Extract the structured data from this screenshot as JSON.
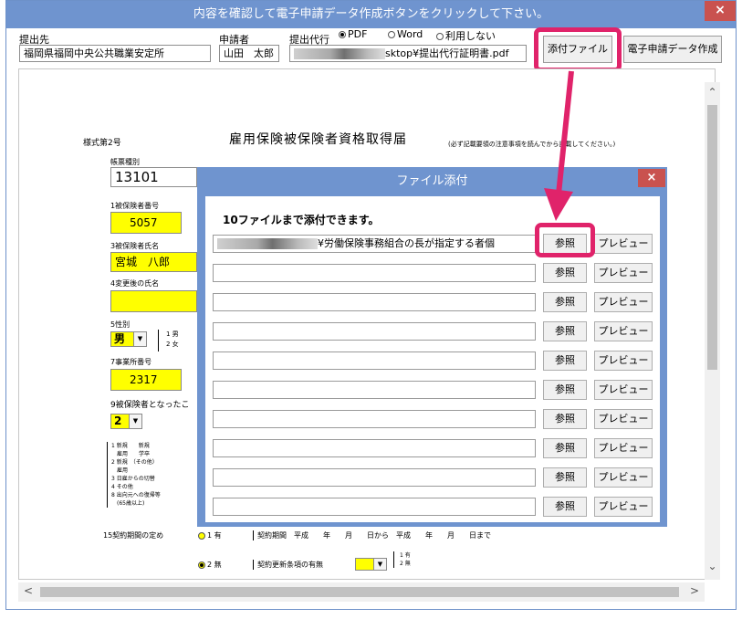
{
  "window": {
    "title": "内容を確認して電子申請データ作成ボタンをクリックして下さい。",
    "close": "×"
  },
  "header": {
    "dest_label": "提出先",
    "dest_value": "福岡県福岡中央公共職業安定所",
    "applicant_label": "申請者",
    "applicant_value": "山田　太郎",
    "proxy_label": "提出代行",
    "radio_pdf": "PDF",
    "radio_word": "Word",
    "radio_none": "利用しない",
    "proxy_path": "sktop¥提出代行証明書.pdf",
    "attach_button": "添付ファイル",
    "create_button": "電子申請データ作成"
  },
  "form": {
    "style_no": "様式第2号",
    "title": "雇用保険被保険者資格取得届",
    "note": "(必ず記載要領の注意事項を読んでから記載してください。)",
    "form_type_label": "帳票種別",
    "form_type_value": "13101",
    "field1_label": "1被保険者番号",
    "field1_value": "5057",
    "field3_label": "3被保険者氏名",
    "field3_value": "宮城　八郎",
    "field4_label": "4変更後の氏名",
    "field5_label": "5性別",
    "field5_value": "男",
    "field5_opt1": "1 男",
    "field5_opt2": "2 女",
    "field7_label": "7事業所番号",
    "field7_value": "2317",
    "field9_label": "9被保険者となったこ",
    "field9_value": "2",
    "list_items": [
      "1 新規　　新規",
      "　雇用　　学卒",
      "2 新規　（その他）",
      "　雇用",
      "3 日雇からの切替",
      "4 その他",
      "8 出向元への復帰等",
      "　(65歳以上)"
    ],
    "field15_label": "15契約期間の定め",
    "opt1_label": "1 有",
    "opt2_label": "2 無",
    "contract_period": "契約期間　平成　　年　　月　　日から　平成　　年　　月　　日まで",
    "renewal_label": "契約更新条項の有無",
    "renewal_opt1": "1 有",
    "renewal_opt2": "2 無"
  },
  "dialog": {
    "title": "ファイル添付",
    "close": "×",
    "note": "10ファイルまで添付できます。",
    "first_path": "¥労働保険事務組合の長が指定する者個",
    "ref_label": "参照",
    "preview_label": "プレビュー",
    "rows": 10
  },
  "colors": {
    "titlebar": "#6f94cf",
    "highlight": "#e0236a",
    "yellow": "#ffff00",
    "close": "#c9524f"
  }
}
